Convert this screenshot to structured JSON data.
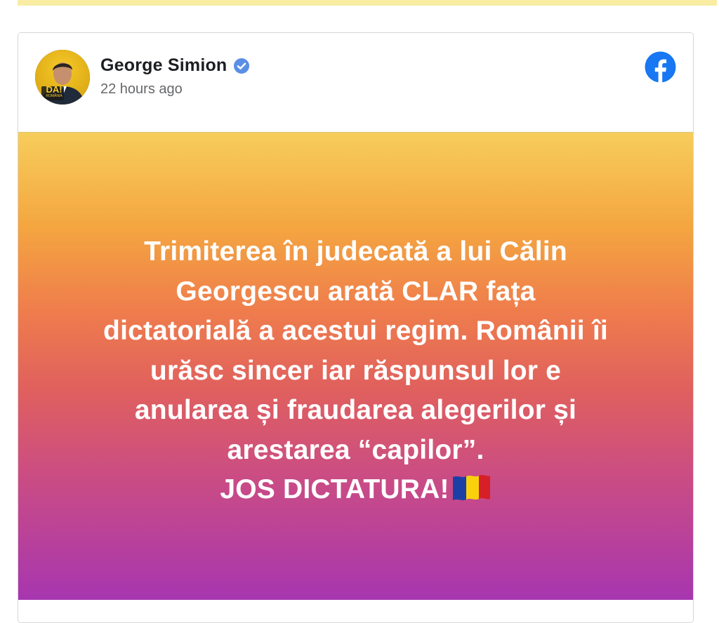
{
  "post": {
    "author": "George Simion",
    "verified": true,
    "timestamp": "22 hours ago",
    "platform_icon": "facebook-icon",
    "avatar_badge": "DA!",
    "avatar_badge_sub": "ROMÂNIA",
    "text_lines": [
      "Trimiterea în judecată a lui Călin",
      "Georgescu arată CLAR fața",
      "dictatorială a acestui regim. Românii îi",
      "urăsc sincer iar răspunsul lor e",
      "anularea și fraudarea alegerilor și",
      "arestarea “capilor”."
    ],
    "text_last_line": "JOS DICTATURA!",
    "flag_icon": "romania-flag-icon"
  },
  "colors": {
    "facebook_blue": "#1877f2",
    "verified_blue": "#5b8ee6",
    "gradient_top": "#f7cd5c",
    "gradient_bottom": "#a736b0",
    "banner": "#f8eda3"
  }
}
